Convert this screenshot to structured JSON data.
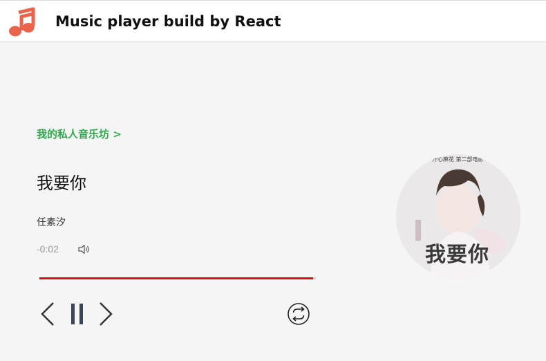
{
  "header": {
    "title": "Music player build by React",
    "logo_icon": "music-note-icon",
    "logo_color": "#e9644b"
  },
  "player": {
    "fm_link": "我的私人音乐坊 >",
    "song_title": "我要你",
    "artist": "任素汐",
    "time_left": "-0:02",
    "progress": 0.99,
    "accent_color": "#d0111b",
    "cover": {
      "title_text": "我要你",
      "top_text": "开心麻花 第二部电影"
    }
  },
  "controls": {
    "prev_icon": "chevron-left-icon",
    "pause_icon": "pause-icon",
    "next_icon": "chevron-right-icon",
    "repeat_icon": "repeat-icon",
    "volume_icon": "speaker-icon"
  }
}
